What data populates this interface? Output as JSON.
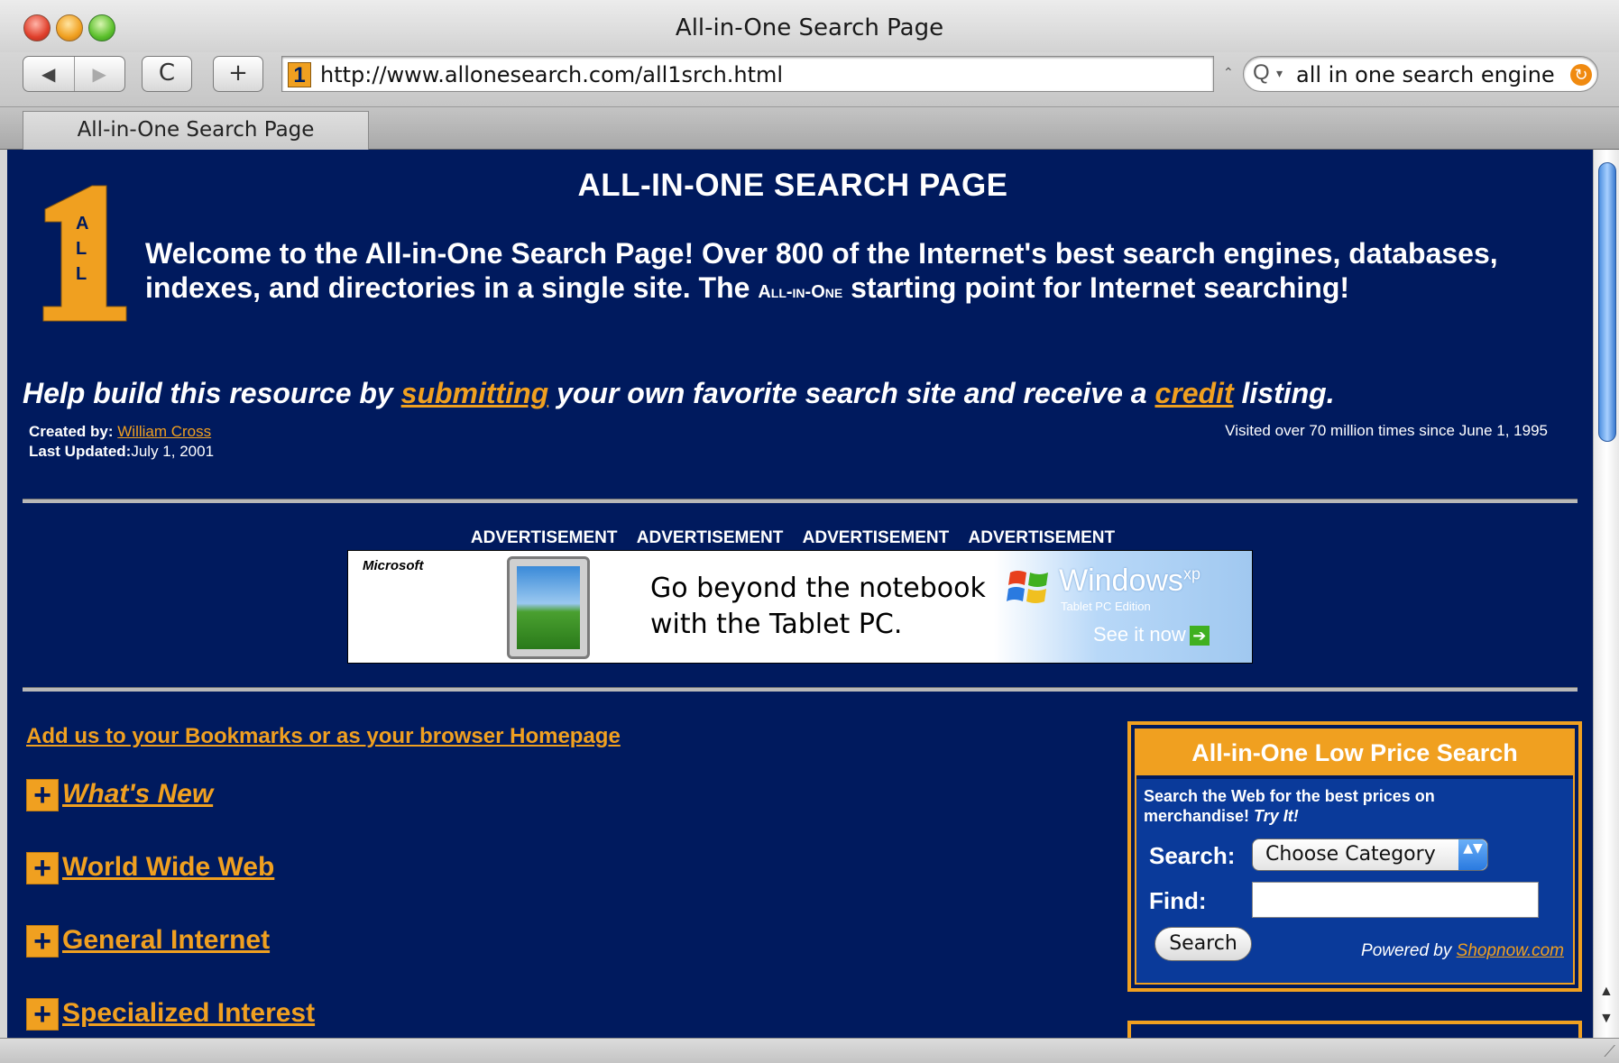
{
  "browser": {
    "window_title": "All-in-One Search Page",
    "url": "http://www.allonesearch.com/all1srch.html",
    "search_query": "all in one search engine",
    "tab_label": "All-in-One Search Page",
    "favicon_text": "1",
    "icons": {
      "back": "◀",
      "forward": "▶",
      "reload": "C",
      "add": "+",
      "search": "Q",
      "dropdown": "▾",
      "snapback": "↻",
      "url_chevron": "⌃",
      "scroll_up": "▲",
      "scroll_down": "▼",
      "resize": "⟋"
    }
  },
  "page": {
    "heading": "ALL-IN-ONE SEARCH PAGE",
    "welcome_part1": "Welcome to the All-in-One Search Page!   Over 800 of the Internet's best search engines, databases, indexes, and directories in a single site.   The ",
    "welcome_smallcaps": "All-in-One",
    "welcome_part2": " starting point for Internet searching!",
    "help_prefix": "Help build this resource by ",
    "help_link1": "submitting",
    "help_middle": " your own favorite search site and receive a ",
    "help_link2": "credit",
    "help_suffix": " listing.",
    "created_label": "Created by: ",
    "created_by": "William Cross",
    "updated_label": "Last Updated:",
    "updated_date": "July 1, 2001",
    "visited": "Visited over 70 million times since June 1, 1995",
    "logo_letters": [
      "A",
      "L",
      "L"
    ],
    "ad_labels": [
      "ADVERTISEMENT",
      "ADVERTISEMENT",
      "ADVERTISEMENT",
      "ADVERTISEMENT"
    ],
    "ad": {
      "brand": "Microsoft",
      "line1": "Go beyond the notebook",
      "line2": "with the Tablet PC.",
      "windows": "Windows",
      "windows_sup": "xp",
      "edition": "Tablet PC Edition",
      "cta": "See it now",
      "cta_arrow": "➔"
    },
    "bookmarks_link": "Add us to your Bookmarks or as your browser Homepage",
    "categories": [
      {
        "label": "What's New"
      },
      {
        "label": "World Wide Web"
      },
      {
        "label": "General Internet"
      },
      {
        "label": "Specialized Interest"
      }
    ],
    "plus_icon": "+",
    "low_price": {
      "title": "All-in-One Low Price Search",
      "desc": "Search the Web for the best prices on merchandise!  ",
      "desc_try": "Try It!",
      "search_label": "Search:",
      "category_value": "Choose Category",
      "select_arrows": "▲▼",
      "find_label": "Find:",
      "find_value": "",
      "button": "Search",
      "powered_prefix": "Powered by ",
      "powered_link": "Shopnow.com"
    }
  },
  "colors": {
    "page_bg": "#001a5e",
    "accent": "#f0a020",
    "text": "#ffffff"
  }
}
